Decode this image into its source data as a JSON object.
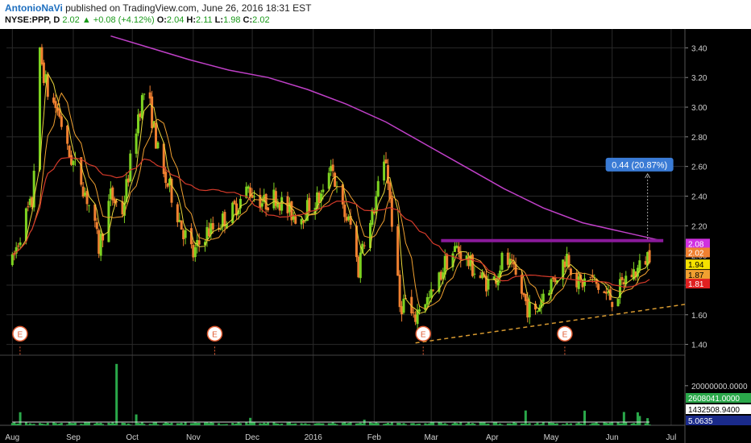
{
  "header": {
    "author": "AntonioNaVi",
    "published": "published on TradingView.com, June 26, 2016 18:31 EST",
    "symbol": "NYSE:PPP, D",
    "last": "2.02",
    "change": "+0.08 (+4.12%)",
    "open_label": "O:",
    "open": "2.04",
    "high_label": "H:",
    "high": "2.11",
    "low_label": "L:",
    "low": "1.98",
    "close_label": "C:",
    "close": "2.02"
  },
  "colors": {
    "background": "#000000",
    "up_candle": "#7ed321",
    "down_candle": "#f08030",
    "ma_fast": "#e8d53a",
    "ma_mid": "#f0a030",
    "ma_slow": "#d43a2a",
    "ma_200": "#c040c8",
    "resistance": "#8a1a9a",
    "support": "#d89a30",
    "volume": "#2aa84a"
  },
  "chart_data": {
    "type": "candlestick",
    "title": "NYSE:PPP, D",
    "ylim": [
      1.3,
      3.5
    ],
    "y_ticks": [
      "3.40",
      "3.20",
      "3.00",
      "2.80",
      "2.60",
      "2.40",
      "2.20",
      "2.00",
      "1.80",
      "1.60",
      "1.40"
    ],
    "x_ticks": [
      "Aug",
      "Sep",
      "Oct",
      "Nov",
      "Dec",
      "2016",
      "Feb",
      "Mar",
      "Apr",
      "May",
      "Jun",
      "Jul"
    ],
    "x_tick_days": [
      0,
      31,
      61,
      92,
      122,
      153,
      184,
      213,
      244,
      274,
      305,
      335
    ],
    "xlim_days": [
      -3,
      342
    ],
    "price_path": [
      [
        0,
        1.95
      ],
      [
        6,
        2.25
      ],
      [
        10,
        2.35
      ],
      [
        14,
        3.35
      ],
      [
        18,
        3.1
      ],
      [
        24,
        2.95
      ],
      [
        28,
        2.7
      ],
      [
        34,
        2.55
      ],
      [
        40,
        2.3
      ],
      [
        44,
        2.05
      ],
      [
        50,
        2.4
      ],
      [
        56,
        2.3
      ],
      [
        64,
        2.95
      ],
      [
        68,
        3.15
      ],
      [
        72,
        2.85
      ],
      [
        76,
        2.55
      ],
      [
        80,
        2.45
      ],
      [
        86,
        2.2
      ],
      [
        92,
        2.0
      ],
      [
        98,
        2.15
      ],
      [
        104,
        2.2
      ],
      [
        112,
        2.3
      ],
      [
        120,
        2.45
      ],
      [
        128,
        2.35
      ],
      [
        134,
        2.4
      ],
      [
        140,
        2.3
      ],
      [
        146,
        2.25
      ],
      [
        152,
        2.35
      ],
      [
        158,
        2.4
      ],
      [
        162,
        2.65
      ],
      [
        166,
        2.35
      ],
      [
        172,
        2.2
      ],
      [
        176,
        1.9
      ],
      [
        178,
        2.1
      ],
      [
        182,
        2.2
      ],
      [
        186,
        2.45
      ],
      [
        190,
        2.65
      ],
      [
        194,
        2.1
      ],
      [
        197,
        1.65
      ],
      [
        200,
        1.7
      ],
      [
        204,
        1.55
      ],
      [
        208,
        1.7
      ],
      [
        212,
        1.7
      ],
      [
        216,
        1.8
      ],
      [
        220,
        1.95
      ],
      [
        226,
        2.05
      ],
      [
        232,
        1.95
      ],
      [
        238,
        1.85
      ],
      [
        244,
        1.8
      ],
      [
        250,
        2.0
      ],
      [
        256,
        1.85
      ],
      [
        262,
        1.65
      ],
      [
        266,
        1.6
      ],
      [
        270,
        1.75
      ],
      [
        276,
        1.85
      ],
      [
        282,
        2.0
      ],
      [
        288,
        1.8
      ],
      [
        294,
        1.85
      ],
      [
        300,
        1.75
      ],
      [
        306,
        1.7
      ],
      [
        312,
        1.85
      ],
      [
        318,
        1.9
      ],
      [
        324,
        2.02
      ]
    ],
    "ma_200_path": [
      [
        50,
        3.48
      ],
      [
        70,
        3.4
      ],
      [
        90,
        3.32
      ],
      [
        110,
        3.25
      ],
      [
        130,
        3.2
      ],
      [
        150,
        3.12
      ],
      [
        170,
        3.02
      ],
      [
        190,
        2.9
      ],
      [
        210,
        2.75
      ],
      [
        230,
        2.6
      ],
      [
        250,
        2.45
      ],
      [
        270,
        2.32
      ],
      [
        290,
        2.22
      ],
      [
        310,
        2.16
      ],
      [
        330,
        2.1
      ]
    ],
    "resistance": {
      "value": 2.1,
      "from_day": 218,
      "to_day": 331
    },
    "support": {
      "from_day": 205,
      "from_value": 1.41,
      "to_day": 342,
      "to_value": 1.67
    },
    "measure_label": "0.44 (20.87%)",
    "measure": {
      "day": 323,
      "from_value": 2.11,
      "to_value": 2.55
    },
    "price_tags": [
      {
        "value": 2.08,
        "label": "2.08",
        "bg": "#d030e0",
        "fg": "#ffffff"
      },
      {
        "value": 2.02,
        "label": "2.02",
        "bg": "#f08030",
        "fg": "#ffffff"
      },
      {
        "value": 1.94,
        "label": "1.94",
        "bg": "#f5e100",
        "fg": "#000000"
      },
      {
        "value": 1.87,
        "label": "1.87",
        "bg": "#f0a030",
        "fg": "#000000"
      },
      {
        "value": 1.81,
        "label": "1.81",
        "bg": "#e02020",
        "fg": "#ffffff"
      }
    ],
    "earnings": [
      {
        "day": -1,
        "label": "E"
      },
      {
        "day": 98,
        "label": "E"
      },
      {
        "day": 204,
        "label": "E"
      },
      {
        "day": 276,
        "label": "E"
      }
    ],
    "volume": {
      "ylim": [
        0,
        35000000
      ],
      "y_tick": "20000000.0000",
      "tags": [
        {
          "label": "2608041.0000",
          "bg": "#2aa84a",
          "fg": "#ffffff"
        },
        {
          "label": "1432508.9400",
          "bg": "#ffffff",
          "fg": "#000000"
        },
        {
          "label": "5.0635",
          "bg": "#1a2a8a",
          "fg": "#ffffff"
        }
      ]
    }
  }
}
